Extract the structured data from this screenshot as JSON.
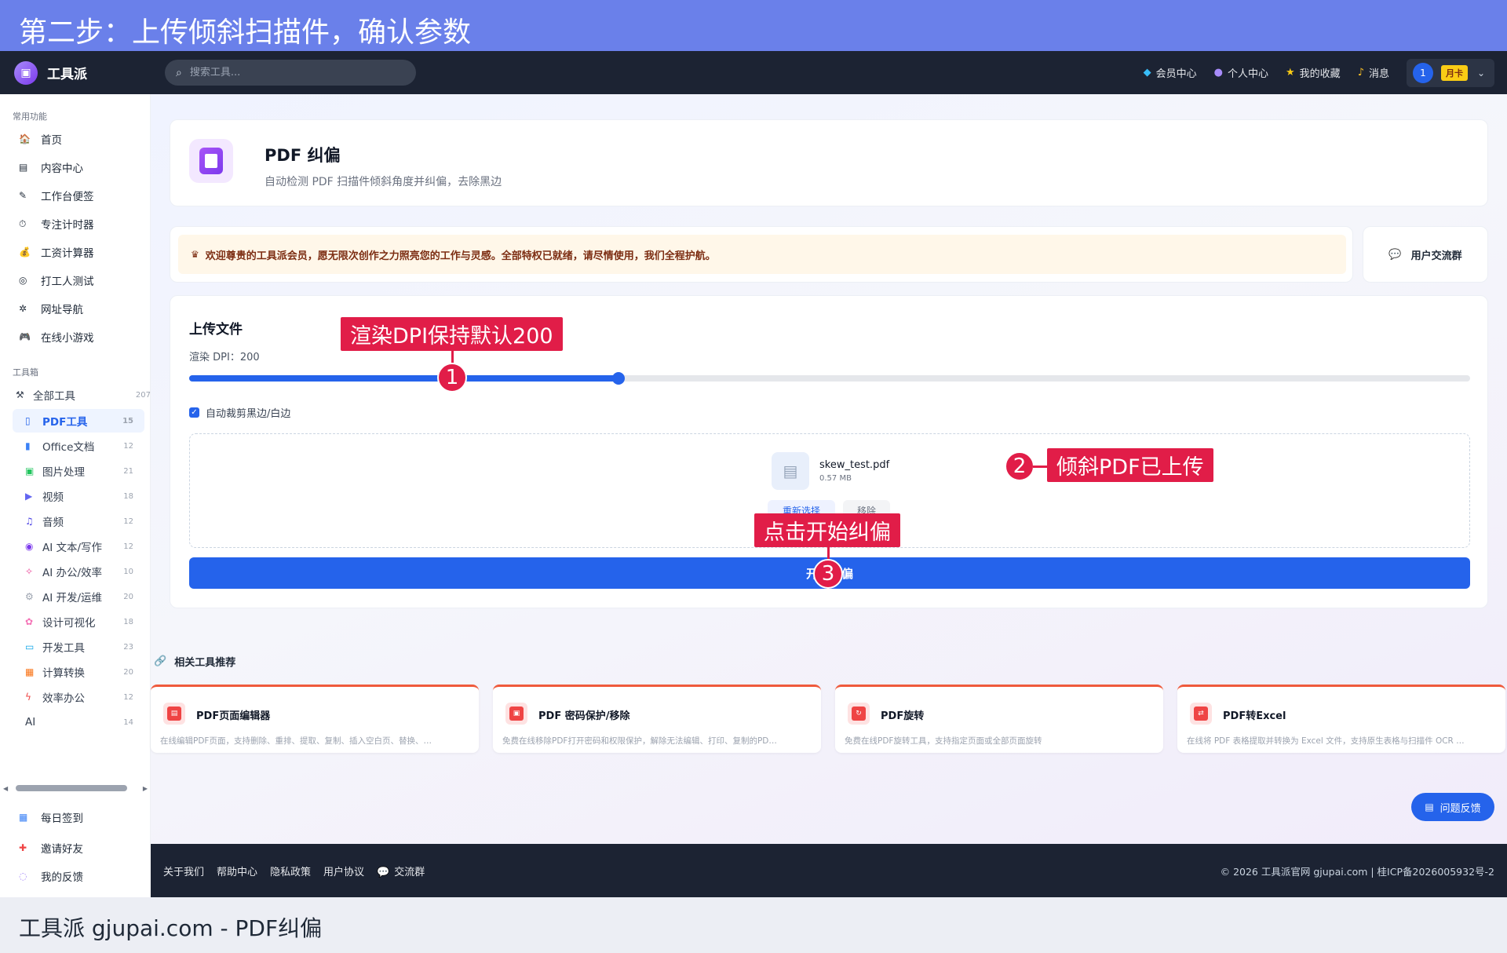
{
  "banner": {
    "text": "第二步：上传倾斜扫描件，确认参数"
  },
  "header": {
    "app_name": "工具派",
    "search_placeholder": "搜索工具...",
    "nav": [
      {
        "label": "会员中心",
        "icon": "diamond-icon"
      },
      {
        "label": "个人中心",
        "icon": "user-icon"
      },
      {
        "label": "我的收藏",
        "icon": "star-icon"
      },
      {
        "label": "消息",
        "icon": "bell-icon"
      }
    ],
    "user": {
      "avatar": "1",
      "badge": "月卡"
    }
  },
  "sidebar": {
    "common_title": "常用功能",
    "common": [
      {
        "label": "首页",
        "icon": "home-icon"
      },
      {
        "label": "内容中心",
        "icon": "newspaper-icon"
      },
      {
        "label": "工作台便签",
        "icon": "memo-icon"
      },
      {
        "label": "专注计时器",
        "icon": "stopwatch-icon"
      },
      {
        "label": "工资计算器",
        "icon": "money-bag-icon"
      },
      {
        "label": "打工人测试",
        "icon": "target-icon"
      },
      {
        "label": "网址导航",
        "icon": "compass-icon"
      },
      {
        "label": "在线小游戏",
        "icon": "gamepad-icon"
      }
    ],
    "toolbox_title": "工具箱",
    "all_tools": {
      "label": "全部工具",
      "count": "207"
    },
    "tools": [
      {
        "label": "PDF工具",
        "count": "15",
        "icon": "pdf-icon"
      },
      {
        "label": "Office文档",
        "count": "12",
        "icon": "document-icon"
      },
      {
        "label": "图片处理",
        "count": "21",
        "icon": "image-icon"
      },
      {
        "label": "视频",
        "count": "18",
        "icon": "clapper-icon"
      },
      {
        "label": "音频",
        "count": "12",
        "icon": "music-icon"
      },
      {
        "label": "AI 文本/写作",
        "count": "12",
        "icon": "robot-icon"
      },
      {
        "label": "AI 办公/效率",
        "count": "10",
        "icon": "wand-icon"
      },
      {
        "label": "AI 开发/运维",
        "count": "20",
        "icon": "wrench-icon"
      },
      {
        "label": "设计可视化",
        "count": "18",
        "icon": "palette-icon"
      },
      {
        "label": "开发工具",
        "count": "23",
        "icon": "monitor-icon"
      },
      {
        "label": "计算转换",
        "count": "20",
        "icon": "calculator-icon"
      },
      {
        "label": "效率办公",
        "count": "12",
        "icon": "lightning-icon"
      },
      {
        "label": "AI",
        "count": "14",
        "icon": ""
      }
    ],
    "bottom": [
      {
        "label": "每日签到",
        "icon": "calendar-icon"
      },
      {
        "label": "邀请好友",
        "icon": "gift-icon"
      },
      {
        "label": "我的反馈",
        "icon": "speech-icon"
      }
    ]
  },
  "tool": {
    "name": "PDF 纠偏",
    "description": "自动检测 PDF 扫描件倾斜角度并纠偏，去除黑边"
  },
  "welcome": {
    "text": "欢迎尊贵的工具派会员，愿无限次创作之力照亮您的工作与灵感。全部特权已就绪，请尽情使用，我们全程护航。"
  },
  "community": {
    "label": "用户交流群"
  },
  "upload": {
    "title": "上传文件",
    "dpi_label": "渲染 DPI：200",
    "dpi_value": 200,
    "dpi_fill_fraction": 0.335,
    "auto_crop_label": "自动裁剪黑边/白边",
    "auto_crop_checked": true,
    "file_name": "skew_test.pdf",
    "file_size": "0.57 MB",
    "reselect_label": "重新选择",
    "remove_label": "移除",
    "start_label": "开始纠偏"
  },
  "related": {
    "title": "相关工具推荐",
    "items": [
      {
        "name": "PDF页面编辑器",
        "desc": "在线编辑PDF页面，支持删除、重排、提取、复制、插入空白页、替换、…"
      },
      {
        "name": "PDF 密码保护/移除",
        "desc": "免费在线移除PDF打开密码和权限保护，解除无法编辑、打印、复制的PD…"
      },
      {
        "name": "PDF旋转",
        "desc": "免费在线PDF旋转工具，支持指定页面或全部页面旋转"
      },
      {
        "name": "PDF转Excel",
        "desc": "在线将 PDF 表格提取并转换为 Excel 文件，支持原生表格与扫描件 OCR …"
      }
    ]
  },
  "feedback": {
    "label": "问题反馈"
  },
  "footer": {
    "links": [
      "关于我们",
      "帮助中心",
      "隐私政策",
      "用户协议",
      "交流群"
    ],
    "copyright": "© 2026 工具派官网 gjupai.com | 桂ICP备2026005932号-2"
  },
  "caption": {
    "text": "工具派 gjupai.com - PDF纠偏"
  },
  "annotations": [
    {
      "number": "1",
      "label": "渲染DPI保持默认200"
    },
    {
      "number": "2",
      "label": "倾斜PDF已上传"
    },
    {
      "number": "3",
      "label": "点击开始纠偏"
    }
  ],
  "colors": {
    "banner": "#6a80ea",
    "accent": "#2563eb",
    "annotation": "#e11d48",
    "header_bg": "#1c2333"
  }
}
